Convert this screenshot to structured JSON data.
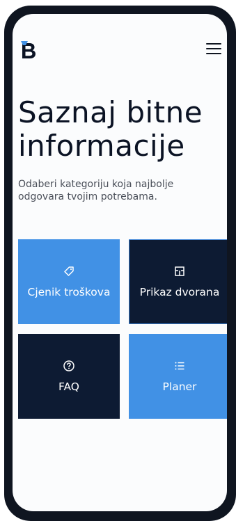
{
  "header": {
    "logo_icon": "brand-b-logo-icon",
    "menu_icon": "hamburger-menu-icon"
  },
  "main": {
    "title": "Saznaj bitne informacije",
    "subtitle": "Odaberi kategoriju koja najbolje odgovara tvojim potrebama."
  },
  "tiles": [
    {
      "label": "Cjenik troškova",
      "icon": "tag-icon",
      "color": "#4191e5"
    },
    {
      "label": "Prikaz dvorana",
      "icon": "floor-plan-icon",
      "color": "#0d1b33"
    },
    {
      "label": "FAQ",
      "icon": "help-circle-icon",
      "color": "#0d1b33"
    },
    {
      "label": "Planer",
      "icon": "list-icon",
      "color": "#4191e5"
    }
  ],
  "colors": {
    "accent_blue": "#4191e5",
    "dark_navy": "#0d1b33",
    "text_dark": "#0b1324",
    "text_muted": "#4a4f59"
  }
}
